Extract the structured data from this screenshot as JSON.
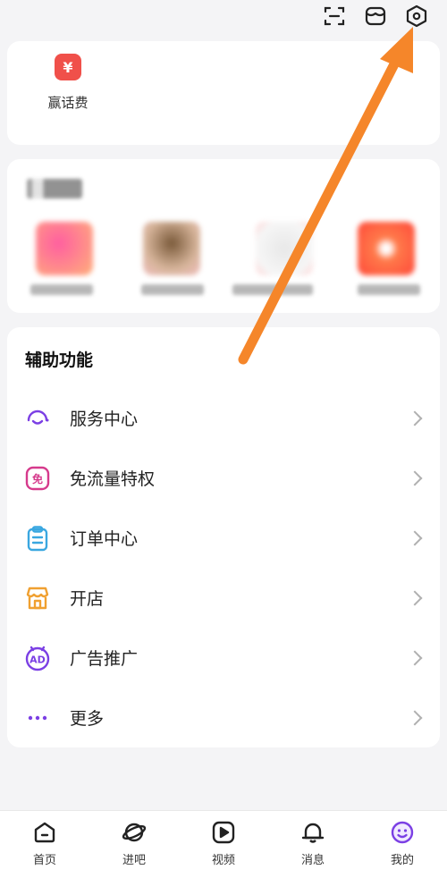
{
  "topbar": {
    "icons": [
      "scan-icon",
      "store-icon",
      "settings-icon"
    ]
  },
  "topup": {
    "label": "赢话费",
    "icon_glyph": "¥"
  },
  "aux": {
    "title": "辅助功能",
    "items": [
      {
        "label": "服务中心",
        "icon": "headset-icon",
        "color": "#7b3fe4"
      },
      {
        "label": "免流量特权",
        "icon": "free-data-icon",
        "color": "#d63a8c",
        "glyph": "免"
      },
      {
        "label": "订单中心",
        "icon": "clipboard-icon",
        "color": "#3aa7e0"
      },
      {
        "label": "开店",
        "icon": "shop-icon",
        "color": "#f0a030"
      },
      {
        "label": "广告推广",
        "icon": "ad-icon",
        "color": "#7b3fe4",
        "glyph": "AD"
      },
      {
        "label": "更多",
        "icon": "more-icon",
        "color": "#7b3fe4"
      }
    ]
  },
  "tabbar": {
    "tabs": [
      {
        "label": "首页",
        "icon": "home-icon"
      },
      {
        "label": "进吧",
        "icon": "planet-icon"
      },
      {
        "label": "视频",
        "icon": "video-icon"
      },
      {
        "label": "消息",
        "icon": "bell-icon"
      },
      {
        "label": "我的",
        "icon": "profile-icon",
        "active": true
      }
    ]
  },
  "colors": {
    "accent_purple": "#7b3fe4",
    "annotation_arrow": "#f5862a",
    "background": "#f4f4f6"
  }
}
